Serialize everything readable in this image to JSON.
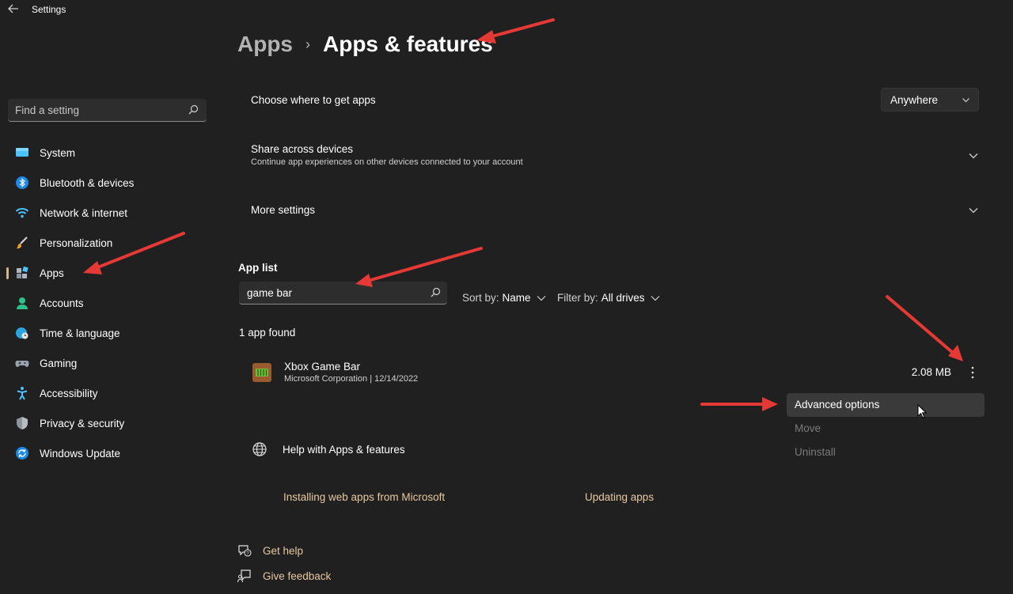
{
  "window": {
    "title": "Settings"
  },
  "search": {
    "placeholder": "Find a setting"
  },
  "sidebar": {
    "items": [
      {
        "label": "System",
        "icon": "monitor-icon"
      },
      {
        "label": "Bluetooth & devices",
        "icon": "bluetooth-icon"
      },
      {
        "label": "Network & internet",
        "icon": "wifi-icon"
      },
      {
        "label": "Personalization",
        "icon": "brush-icon"
      },
      {
        "label": "Apps",
        "icon": "apps-icon",
        "active": true
      },
      {
        "label": "Accounts",
        "icon": "person-icon"
      },
      {
        "label": "Time & language",
        "icon": "globe-clock-icon"
      },
      {
        "label": "Gaming",
        "icon": "gamepad-icon"
      },
      {
        "label": "Accessibility",
        "icon": "accessibility-icon"
      },
      {
        "label": "Privacy & security",
        "icon": "shield-icon"
      },
      {
        "label": "Windows Update",
        "icon": "update-icon"
      }
    ]
  },
  "header": {
    "parent": "Apps",
    "separator": "›",
    "current": "Apps & features"
  },
  "settings": {
    "choose_where": {
      "label": "Choose where to get apps",
      "value": "Anywhere"
    },
    "share": {
      "label": "Share across devices",
      "description": "Continue app experiences on other devices connected to your account"
    },
    "more": {
      "label": "More settings"
    }
  },
  "app_list": {
    "title": "App list",
    "search_value": "game bar",
    "sort_label": "Sort by:",
    "sort_value": "Name",
    "filter_label": "Filter by:",
    "filter_value": "All drives",
    "found": "1 app found",
    "apps": [
      {
        "name": "Xbox Game Bar",
        "publisher": "Microsoft Corporation",
        "date": "12/14/2022",
        "meta": "Microsoft Corporation  |  12/14/2022",
        "size": "2.08 MB"
      }
    ]
  },
  "context_menu": {
    "items": [
      {
        "label": "Advanced options",
        "state": "hover"
      },
      {
        "label": "Move",
        "state": "disabled"
      },
      {
        "label": "Uninstall",
        "state": "disabled"
      }
    ]
  },
  "help": {
    "title": "Help with Apps & features",
    "links": [
      "Installing web apps from Microsoft",
      "Updating apps"
    ]
  },
  "footer": {
    "get_help": "Get help",
    "give_feedback": "Give feedback"
  },
  "colors": {
    "background": "#202020",
    "accent": "#d7b58b",
    "link": "#e7c89f",
    "annotation_arrow": "#e53935"
  }
}
